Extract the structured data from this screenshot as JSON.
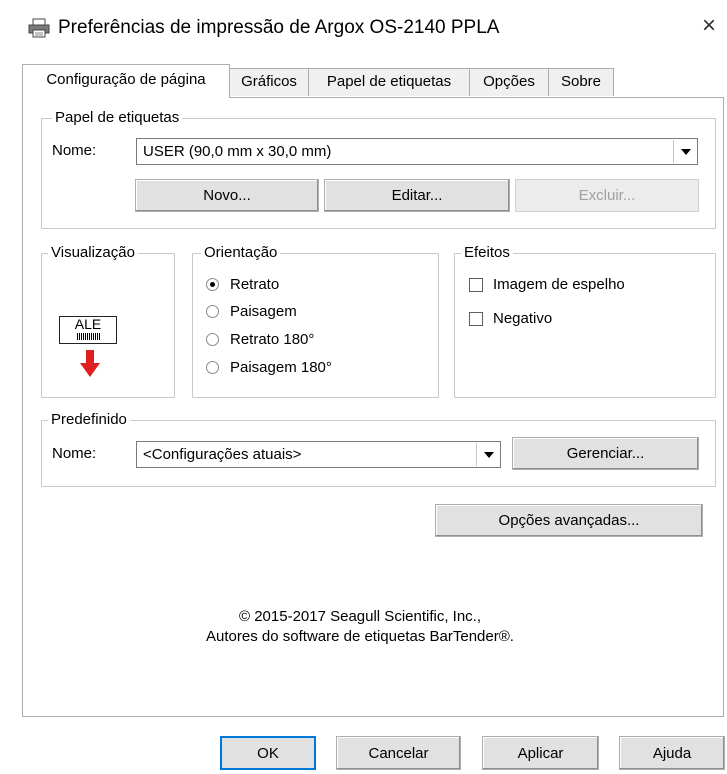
{
  "window": {
    "title": "Preferências de impressão de Argox OS-2140 PPLA",
    "close_symbol": "×",
    "icon": "printer-icon"
  },
  "tabs": [
    {
      "label": "Configuração de página",
      "active": true
    },
    {
      "label": "Gráficos",
      "active": false
    },
    {
      "label": "Papel de etiquetas",
      "active": false
    },
    {
      "label": "Opções",
      "active": false
    },
    {
      "label": "Sobre",
      "active": false
    }
  ],
  "label_paper": {
    "legend": "Papel de etiquetas",
    "name_label": "Nome:",
    "name_value": "USER (90,0 mm x 30,0 mm)",
    "new_button": "Novo...",
    "edit_button": "Editar...",
    "delete_button": "Excluir..."
  },
  "preview": {
    "legend": "Visualização",
    "label_text": "ALE"
  },
  "orientation": {
    "legend": "Orientação",
    "options": [
      {
        "label": "Retrato",
        "selected": true
      },
      {
        "label": "Paisagem",
        "selected": false
      },
      {
        "label": "Retrato 180°",
        "selected": false
      },
      {
        "label": "Paisagem 180°",
        "selected": false
      }
    ]
  },
  "effects": {
    "legend": "Efeitos",
    "mirror_label": "Imagem de espelho",
    "mirror_checked": false,
    "negative_label": "Negativo",
    "negative_checked": false
  },
  "preset": {
    "legend": "Predefinido",
    "name_label": "Nome:",
    "name_value": "<Configurações atuais>",
    "manage_button": "Gerenciar..."
  },
  "advanced_button": "Opções avançadas...",
  "copyright": {
    "line1": "© 2015-2017 Seagull Scientific, Inc.,",
    "line2": "Autores do software de etiquetas BarTender®."
  },
  "footer": {
    "ok": "OK",
    "cancel": "Cancelar",
    "apply": "Aplicar",
    "help": "Ajuda"
  },
  "colors": {
    "accent": "#0078d7",
    "arrow_red": "#e02020"
  }
}
